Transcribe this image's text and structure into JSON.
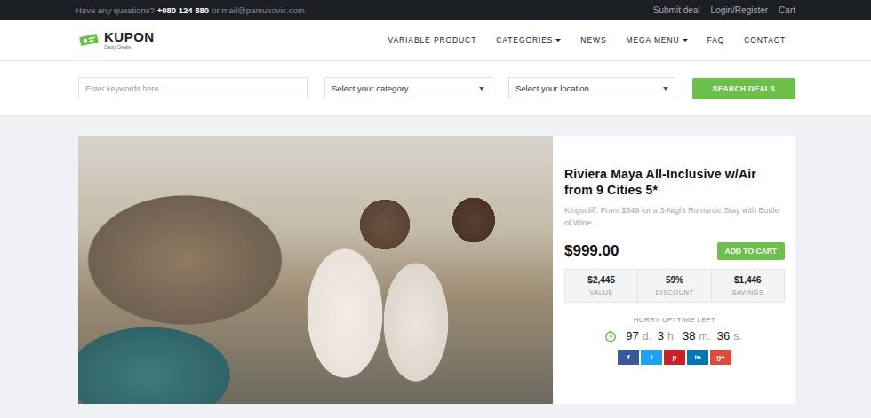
{
  "top_bar": {
    "question": "Have any questions?",
    "phone": "+080 124 880",
    "connector": "or",
    "email": "mail@pamukovic.com",
    "links": [
      "Submit deal",
      "Login/Register",
      "Cart"
    ]
  },
  "logo": {
    "name": "KUPON",
    "tagline": "Daily Deals"
  },
  "nav": [
    {
      "label": "VARIABLE PRODUCT",
      "dropdown": false
    },
    {
      "label": "CATEGORIES",
      "dropdown": true
    },
    {
      "label": "NEWS",
      "dropdown": false
    },
    {
      "label": "MEGA MENU",
      "dropdown": true
    },
    {
      "label": "FAQ",
      "dropdown": false
    },
    {
      "label": "CONTACT",
      "dropdown": false
    }
  ],
  "search": {
    "placeholder": "Enter keywords here",
    "category": "Select your category",
    "location": "Select your location",
    "button": "SEARCH DEALS"
  },
  "deal": {
    "title": "Riviera Maya All-Inclusive w/Air from 9 Cities 5*",
    "description": "Kingscliff: From $349 for a 3-Night Romantic Stay with Bottle of Wine...",
    "price": "$999.00",
    "button": "ADD TO CART",
    "stats": [
      {
        "value": "$2,445",
        "label": "VALUE"
      },
      {
        "value": "59%",
        "label": "DISCOUNT"
      },
      {
        "value": "$1,446",
        "label": "SAVINGS"
      }
    ],
    "countdown_label": "HURRY UP! TIME LEFT",
    "countdown": [
      {
        "value": "97",
        "unit": "d."
      },
      {
        "value": "3",
        "unit": "h."
      },
      {
        "value": "38",
        "unit": "m."
      },
      {
        "value": "36",
        "unit": "s."
      }
    ],
    "share": [
      {
        "icon": "f",
        "color": "#3b5998"
      },
      {
        "icon": "t",
        "color": "#1da1f2"
      },
      {
        "icon": "p",
        "color": "#cb2027"
      },
      {
        "icon": "in",
        "color": "#0077b5"
      },
      {
        "icon": "g+",
        "color": "#dd4b39"
      }
    ]
  }
}
